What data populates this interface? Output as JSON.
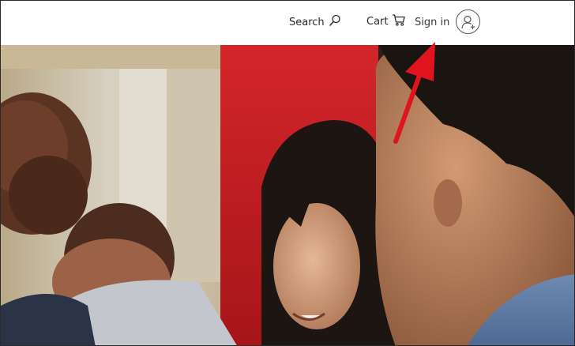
{
  "header": {
    "search_label": "Search",
    "cart_label": "Cart",
    "signin_label": "Sign in",
    "icons": {
      "search": "search-icon",
      "cart": "cart-icon",
      "account": "account-add-icon"
    }
  },
  "annotation": {
    "arrow_color": "#e0141e"
  },
  "colors": {
    "text": "#2b2b2b",
    "hero_red": "#c81e1e"
  }
}
